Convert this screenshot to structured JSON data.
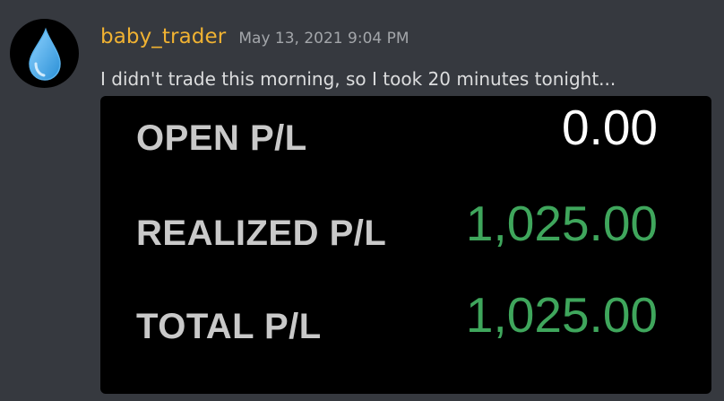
{
  "message": {
    "avatar_icon": "water-drop-icon",
    "username": "baby_trader",
    "timestamp": "May 13, 2021 9:04 PM",
    "text": "I didn't trade this morning, so I took 20 minutes tonight...",
    "colors": {
      "background": "#36393f",
      "username": "#f0b232",
      "timestamp": "#a3a6aa",
      "text": "#dcddde"
    }
  },
  "attachment": {
    "rows": [
      {
        "label": "OPEN P/L",
        "value": "0.00",
        "color": "#ffffff"
      },
      {
        "label": "REALIZED P/L",
        "value": "1,025.00",
        "color": "#3fa65c"
      },
      {
        "label": "TOTAL P/L",
        "value": "1,025.00",
        "color": "#3fa65c"
      }
    ],
    "colors": {
      "background": "#000000",
      "label": "#c9c9c9"
    }
  }
}
